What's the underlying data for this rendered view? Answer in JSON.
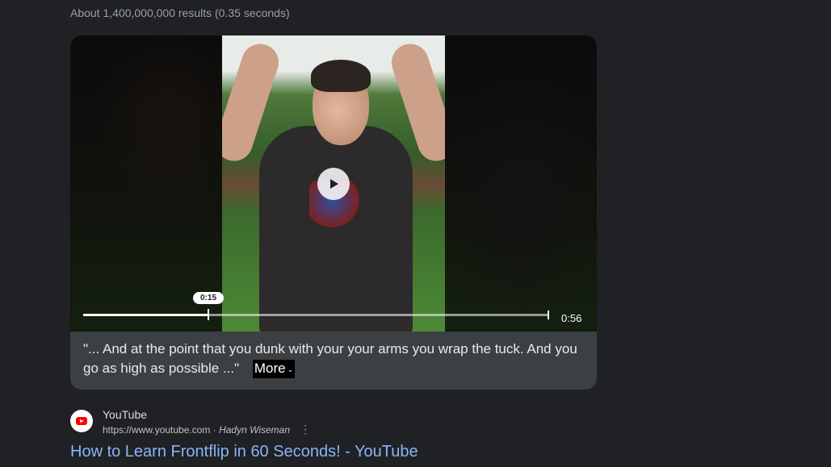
{
  "search": {
    "result_stats": "About 1,400,000,000 results (0.35 seconds)"
  },
  "video": {
    "current_time_label": "0:15",
    "duration_label": "0:56",
    "progress_fraction": 0.268,
    "transcript": "\"... And at the point that you dunk with your your arms you wrap the tuck. And you go as high as possible ...\"",
    "more_label": "More",
    "icons": [
      "play-icon",
      "chevron-down-icon"
    ]
  },
  "result": {
    "site_name": "YouTube",
    "url": "https://www.youtube.com",
    "separator": " · ",
    "author": "Hadyn Wiseman",
    "menu_icon": "⋮",
    "title": "How to Learn Frontflip in 60 Seconds! - YouTube",
    "favicon": "youtube-icon"
  },
  "colors": {
    "background": "#202124",
    "link": "#8ab4f8",
    "card": "#3c4043"
  }
}
